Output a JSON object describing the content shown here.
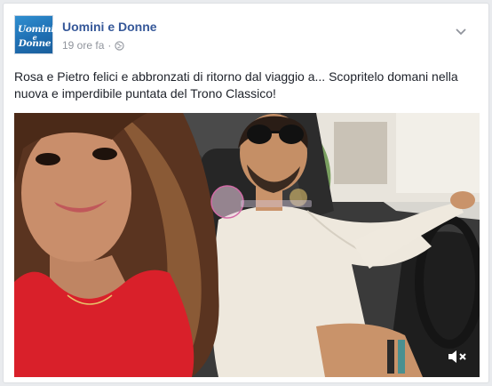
{
  "post": {
    "page_name": "Uomini e Donne",
    "timestamp": "19 ore fa",
    "separator": "·",
    "text": "Rosa e Pietro felici e abbronzati di ritorno dal viaggio a... Scopritelo domani nella nuova e imperdibile puntata del Trono Classico!",
    "avatar_logo": [
      "Uomini",
      "e",
      "Donne"
    ],
    "privacy_icon": "globe-icon",
    "options_icon": "chevron-down-icon"
  },
  "video": {
    "sound_icon": "mute-icon",
    "description_colors": {
      "dress": "#d9202a",
      "shirt": "#f2ede4",
      "car_interior": "#2b2b2b"
    }
  },
  "colors": {
    "link": "#365899",
    "meta": "#90949c",
    "text": "#1d2129",
    "background": "#e9ebee"
  }
}
